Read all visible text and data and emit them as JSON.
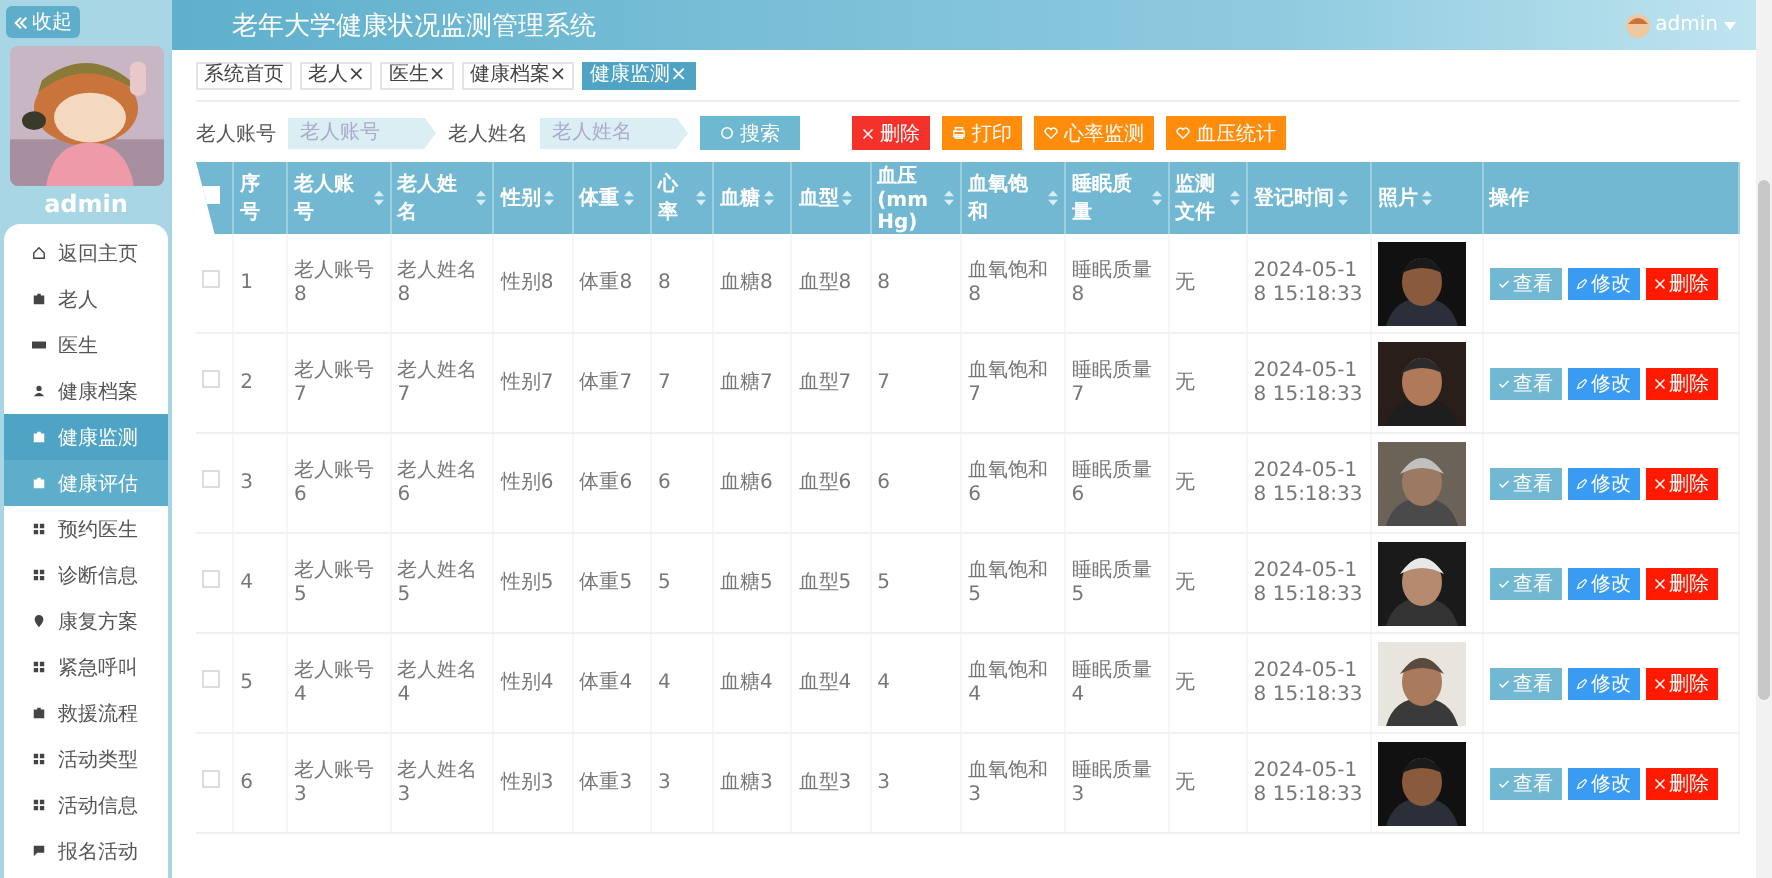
{
  "sidebar": {
    "collapse_button": "收起",
    "avatar": {
      "kind": "picture"
    },
    "user": "admin",
    "menu": [
      {
        "label": "返回主页",
        "selected": false,
        "hovered": false
      },
      {
        "label": "老人",
        "selected": false,
        "hovered": false
      },
      {
        "label": "医生",
        "selected": false,
        "hovered": false
      },
      {
        "label": "健康档案",
        "selected": false,
        "hovered": false
      },
      {
        "label": "健康监测",
        "selected": true,
        "hovered": false
      },
      {
        "label": "健康评估",
        "selected": false,
        "hovered": true
      },
      {
        "label": "预约医生",
        "selected": false,
        "hovered": false
      },
      {
        "label": "诊断信息",
        "selected": false,
        "hovered": false
      },
      {
        "label": "康复方案",
        "selected": false,
        "hovered": false
      },
      {
        "label": "紧急呼叫",
        "selected": false,
        "hovered": false
      },
      {
        "label": "救援流程",
        "selected": false,
        "hovered": false
      },
      {
        "label": "活动类型",
        "selected": false,
        "hovered": false
      },
      {
        "label": "活动信息",
        "selected": false,
        "hovered": false
      },
      {
        "label": "报名活动",
        "selected": false,
        "hovered": false
      }
    ]
  },
  "header": {
    "title": "老年大学健康状况监测管理系统",
    "user": "admin"
  },
  "tabs": [
    {
      "label": "系统首页",
      "selected": false
    },
    {
      "label": "老人",
      "close": "×",
      "selected": false
    },
    {
      "label": "医生",
      "close": "×",
      "selected": false
    },
    {
      "label": "健康档案",
      "close": "×",
      "selected": false
    },
    {
      "label": "健康监测",
      "close": "×",
      "selected": true
    }
  ],
  "search": {
    "fields": [
      {
        "label": "老人账号",
        "placeholder": "老人账号"
      },
      {
        "label": "老人姓名",
        "placeholder": "老人姓名"
      }
    ],
    "button": "搜索"
  },
  "actions": [
    {
      "label": "删除",
      "kind": "danger"
    },
    {
      "label": "打印",
      "kind": "print"
    },
    {
      "label": "心率监测",
      "kind": "chart"
    },
    {
      "label": "血压统计",
      "kind": "chart"
    }
  ],
  "table": {
    "select_all": {
      "checked": false
    },
    "columns": [
      {
        "label": "序号",
        "sortable": false
      },
      {
        "label": "老人账号",
        "sortable": true
      },
      {
        "label": "老人姓名",
        "sortable": true
      },
      {
        "label": "性别",
        "sortable": true
      },
      {
        "label": "体重",
        "sortable": true
      },
      {
        "label": "心率",
        "sortable": true
      },
      {
        "label": "血糖",
        "sortable": true
      },
      {
        "label": "血型",
        "sortable": true
      },
      {
        "label": "血压(mmHg)",
        "sortable": true
      },
      {
        "label": "血氧饱和",
        "sortable": true
      },
      {
        "label": "睡眠质量",
        "sortable": true
      },
      {
        "label": "监测文件",
        "sortable": true
      },
      {
        "label": "登记时间",
        "sortable": true
      },
      {
        "label": "照片",
        "sortable": true
      },
      {
        "label": "操作",
        "sortable": false
      }
    ],
    "rows": [
      {
        "checked": false,
        "cells": [
          "1",
          "老人账号8",
          "老人姓名8",
          "性别8",
          "体重8",
          "8",
          "血糖8",
          "血型8",
          "8",
          "血氧饱和8",
          "睡眠质量8",
          "无",
          "2024-05-18 15:18:33"
        ],
        "photo": {
          "kind": "picture"
        },
        "actions": [
          {
            "label": "查看",
            "kind": "view"
          },
          {
            "label": "修改",
            "kind": "edit"
          },
          {
            "label": "删除",
            "kind": "delete"
          }
        ]
      },
      {
        "checked": false,
        "cells": [
          "2",
          "老人账号7",
          "老人姓名7",
          "性别7",
          "体重7",
          "7",
          "血糖7",
          "血型7",
          "7",
          "血氧饱和7",
          "睡眠质量7",
          "无",
          "2024-05-18 15:18:33"
        ],
        "photo": {
          "kind": "picture"
        },
        "actions": [
          {
            "label": "查看",
            "kind": "view"
          },
          {
            "label": "修改",
            "kind": "edit"
          },
          {
            "label": "删除",
            "kind": "delete"
          }
        ]
      },
      {
        "checked": false,
        "cells": [
          "3",
          "老人账号6",
          "老人姓名6",
          "性别6",
          "体重6",
          "6",
          "血糖6",
          "血型6",
          "6",
          "血氧饱和6",
          "睡眠质量6",
          "无",
          "2024-05-18 15:18:33"
        ],
        "photo": {
          "kind": "picture"
        },
        "actions": [
          {
            "label": "查看",
            "kind": "view"
          },
          {
            "label": "修改",
            "kind": "edit"
          },
          {
            "label": "删除",
            "kind": "delete"
          }
        ]
      },
      {
        "checked": false,
        "cells": [
          "4",
          "老人账号5",
          "老人姓名5",
          "性别5",
          "体重5",
          "5",
          "血糖5",
          "血型5",
          "5",
          "血氧饱和5",
          "睡眠质量5",
          "无",
          "2024-05-18 15:18:33"
        ],
        "photo": {
          "kind": "picture"
        },
        "actions": [
          {
            "label": "查看",
            "kind": "view"
          },
          {
            "label": "修改",
            "kind": "edit"
          },
          {
            "label": "删除",
            "kind": "delete"
          }
        ]
      },
      {
        "checked": false,
        "cells": [
          "5",
          "老人账号4",
          "老人姓名4",
          "性别4",
          "体重4",
          "4",
          "血糖4",
          "血型4",
          "4",
          "血氧饱和4",
          "睡眠质量4",
          "无",
          "2024-05-18 15:18:33"
        ],
        "photo": {
          "kind": "picture"
        },
        "actions": [
          {
            "label": "查看",
            "kind": "view"
          },
          {
            "label": "修改",
            "kind": "edit"
          },
          {
            "label": "删除",
            "kind": "delete"
          }
        ]
      },
      {
        "checked": false,
        "cells": [
          "6",
          "老人账号3",
          "老人姓名3",
          "性别3",
          "体重3",
          "3",
          "血糖3",
          "血型3",
          "3",
          "血氧饱和3",
          "睡眠质量3",
          "无",
          "2024-05-18 15:18:33"
        ],
        "photo": {
          "kind": "picture"
        },
        "actions": [
          {
            "label": "查看",
            "kind": "view"
          },
          {
            "label": "修改",
            "kind": "edit"
          },
          {
            "label": "删除",
            "kind": "delete"
          }
        ]
      }
    ]
  }
}
